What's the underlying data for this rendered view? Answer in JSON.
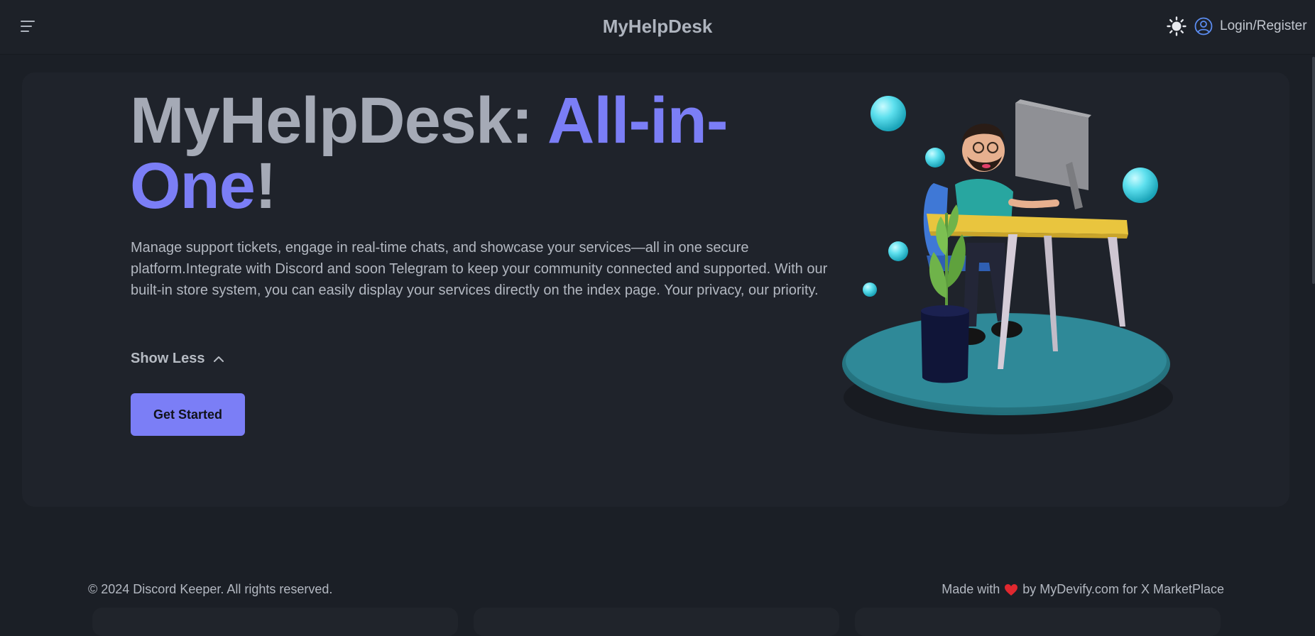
{
  "navbar": {
    "brand": "MyHelpDesk",
    "menu_icon": "hamburger-menu-icon",
    "theme_icon": "sun-icon",
    "user_icon": "user-circle-icon",
    "login_label": "Login/Register"
  },
  "hero": {
    "title_part1": "MyHelpDesk: ",
    "title_accent1": "All-in-",
    "title_accent2": "One",
    "title_end": "!",
    "description": "Manage support tickets, engage in real-time chats, and showcase your services—all in one secure platform.Integrate with Discord and soon Telegram to keep your community connected and supported. With our built-in store system, you can easily display your services directly on the index page. Your privacy, our priority.",
    "toggle_label": "Show Less",
    "toggle_icon": "chevron-up-icon",
    "cta_label": "Get Started",
    "image": "developer-at-desk-illustration"
  },
  "footer": {
    "copyright": "© 2024 Discord Keeper. All rights reserved.",
    "made_with": "Made with",
    "heart_icon": "heart-icon",
    "made_by": "by MyDevify.com for X MarketPlace"
  },
  "colors": {
    "accent": "#7b7ef6",
    "background": "#1b1f26",
    "card": "#1f232b",
    "heart": "#e0282f"
  }
}
